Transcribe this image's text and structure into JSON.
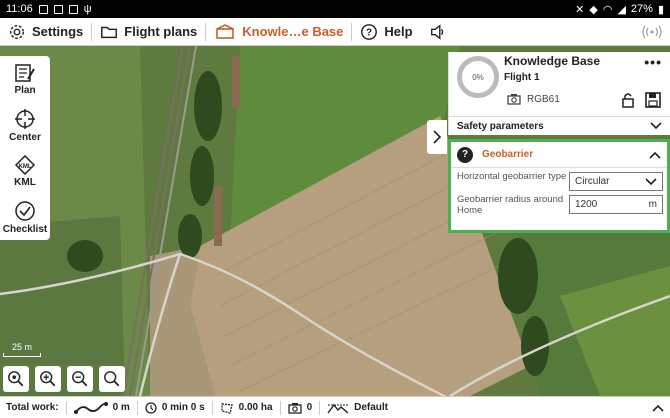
{
  "status_bar": {
    "time": "11:06",
    "battery": "27%"
  },
  "nav": {
    "settings_label": "Settings",
    "flight_plans_label": "Flight plans",
    "knowledge_base_label": "Knowle…e Base",
    "help_label": "Help",
    "active_color": "#c8602a"
  },
  "tools": {
    "plan_label": "Plan",
    "center_label": "Center",
    "kml_label": "KML",
    "checklist_label": "Checklist"
  },
  "scale": {
    "label": "25 m"
  },
  "panel": {
    "title": "Knowledge Base",
    "flight": "Flight 1",
    "progress": "0%",
    "camera": "RGB61",
    "more_menu": "•••",
    "safety_label": "Safety parameters"
  },
  "geobarrier": {
    "title": "Geobarrier",
    "badge": "?",
    "type_label": "Horizontal geobarrier type",
    "type_value": "Circular",
    "radius_label": "Geobarrier radius around Home",
    "radius_value": "1200",
    "radius_unit": "m",
    "highlight_color": "#4caf50"
  },
  "bottom": {
    "label": "Total work:",
    "distance": "0 m",
    "time": "0 min 0 s",
    "area": "0.00 ha",
    "photos": "0",
    "altitude_mode": "Default"
  }
}
